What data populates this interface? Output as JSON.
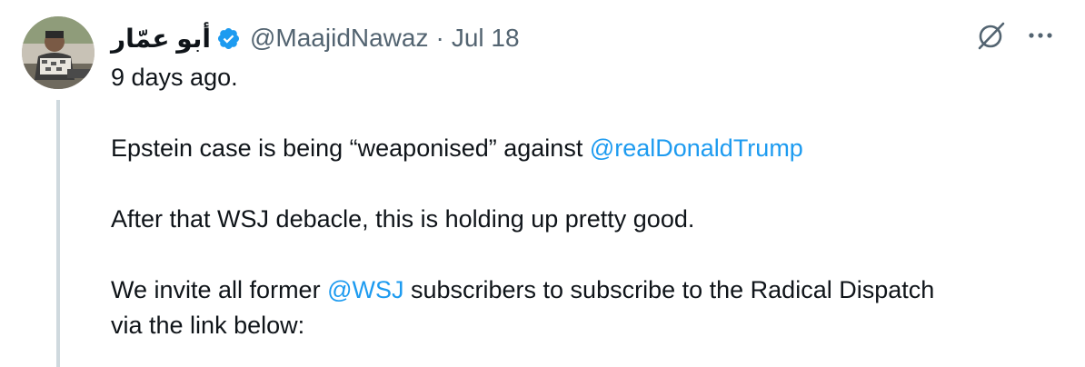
{
  "author": {
    "display_name": "أبو عمّار",
    "handle": "@MaajidNawaz",
    "separator": "·",
    "date": "Jul 18"
  },
  "icons": {
    "verified": "verified-badge-icon",
    "grok": "grok-icon",
    "more": "more-icon"
  },
  "colors": {
    "link": "#1d9bf0",
    "muted": "#536471",
    "thread_line": "#cfd9de"
  },
  "tweet": {
    "line1": "9 days ago.",
    "line2_pre": "Epstein case is being “weaponised” against ",
    "line2_mention": "@realDonaldTrump",
    "line3": "After that WSJ debacle, this is holding up pretty good.",
    "line4_pre": "We invite all former ",
    "line4_mention": "@WSJ",
    "line4_post": " subscribers to subscribe to the Radical Dispatch",
    "line5": "via the link below:"
  }
}
